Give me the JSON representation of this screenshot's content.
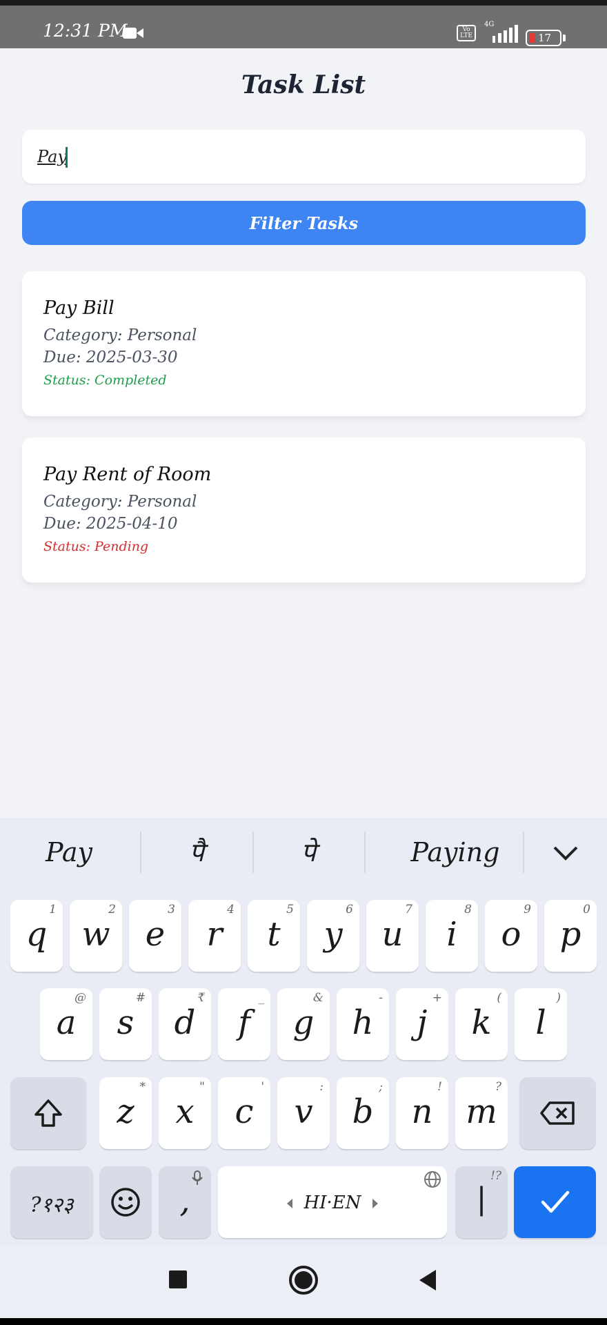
{
  "status_bar": {
    "time": "12:31 PM",
    "volte": "Vo LTE",
    "network": "4G",
    "battery": "17"
  },
  "page": {
    "title": "Task List"
  },
  "search": {
    "value": "Pay"
  },
  "filter_button": {
    "label": "Filter Tasks"
  },
  "tasks": [
    {
      "title": "Pay Bill",
      "category": "Category: Personal",
      "due": "Due: 2025-03-30",
      "status": "Status: Completed",
      "status_color": "#1e9e4a"
    },
    {
      "title": "Pay Rent of Room",
      "category": "Category: Personal",
      "due": "Due: 2025-04-10",
      "status": "Status: Pending",
      "status_color": "#d32f2f"
    }
  ],
  "keyboard": {
    "suggestions": [
      "Pay",
      "पै",
      "पे",
      "Paying"
    ],
    "row1": [
      [
        "q",
        "1"
      ],
      [
        "w",
        "2"
      ],
      [
        "e",
        "3"
      ],
      [
        "r",
        "4"
      ],
      [
        "t",
        "5"
      ],
      [
        "y",
        "6"
      ],
      [
        "u",
        "7"
      ],
      [
        "i",
        "8"
      ],
      [
        "o",
        "9"
      ],
      [
        "p",
        "0"
      ]
    ],
    "row2": [
      [
        "a",
        "@"
      ],
      [
        "s",
        "#"
      ],
      [
        "d",
        "₹"
      ],
      [
        "f",
        "_"
      ],
      [
        "g",
        "&"
      ],
      [
        "h",
        "-"
      ],
      [
        "j",
        "+"
      ],
      [
        "k",
        "("
      ],
      [
        "l",
        ")"
      ]
    ],
    "row3": [
      [
        "z",
        "*"
      ],
      [
        "x",
        "\""
      ],
      [
        "c",
        "'"
      ],
      [
        "v",
        ":"
      ],
      [
        "b",
        ";"
      ],
      [
        "n",
        "!"
      ],
      [
        "m",
        "?"
      ]
    ],
    "symbols_label": "?१२३",
    "comma": ",",
    "space_label": "HI·EN",
    "period": "|",
    "period_sub": "!?"
  },
  "colors": {
    "accent": "#3f84f3",
    "enter_key": "#1a73f0"
  }
}
